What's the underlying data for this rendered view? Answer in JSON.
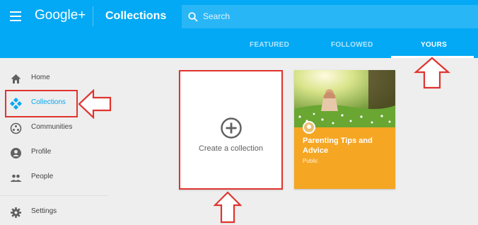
{
  "header": {
    "brand": "Google+",
    "title": "Collections",
    "search_placeholder": "Search"
  },
  "tabs": [
    {
      "label": "FEATURED",
      "active": false
    },
    {
      "label": "FOLLOWED",
      "active": false
    },
    {
      "label": "YOURS",
      "active": true
    }
  ],
  "sidebar": {
    "items": [
      {
        "label": "Home",
        "icon": "home-icon",
        "active": false
      },
      {
        "label": "Collections",
        "icon": "collections-icon",
        "active": true
      },
      {
        "label": "Communities",
        "icon": "communities-icon",
        "active": false
      },
      {
        "label": "Profile",
        "icon": "profile-icon",
        "active": false
      },
      {
        "label": "People",
        "icon": "people-icon",
        "active": false
      },
      {
        "label": "Settings",
        "icon": "gear-icon",
        "active": false
      }
    ]
  },
  "create_card": {
    "label": "Create a collection",
    "icon": "add-circle-icon"
  },
  "collection_card": {
    "title": "Parenting Tips and Advice",
    "visibility": "Public",
    "color": "#f5a623"
  },
  "colors": {
    "brand": "#03a9f4",
    "annotation": "#e0342e",
    "active": "#03a9f4"
  }
}
